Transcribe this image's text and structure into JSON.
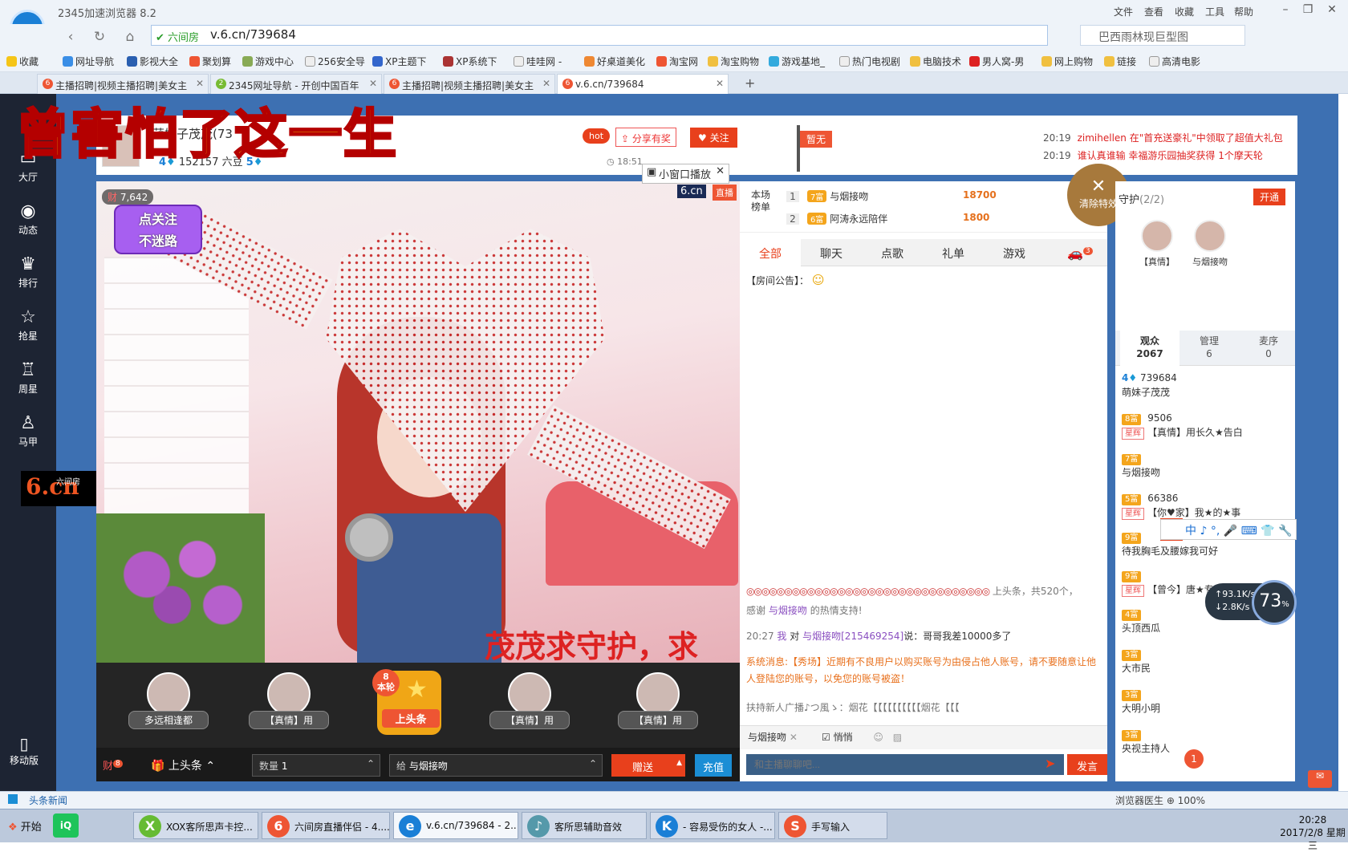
{
  "browser": {
    "app_title": "2345加速浏览器 8.2",
    "logo_letter": "e",
    "menus": [
      "文件",
      "查看",
      "收藏",
      "工具",
      "帮助"
    ],
    "url_badge": "六间房",
    "url": "v.6.cn/739684",
    "search_text": "巴西雨林现巨型图",
    "bookmarks": [
      "收藏",
      "网址导航",
      "影视大全",
      "聚划算",
      "游戏中心",
      "256安全导",
      "XP主题下",
      "XP系统下",
      "哇哇网 -",
      "好桌道美化",
      "淘宝网",
      "淘宝购物",
      "游戏基地_",
      "热门电视剧",
      "电脑技术",
      "男人窝-男",
      "网上购物",
      "链接",
      "高清电影"
    ],
    "tabs": [
      "主播招聘|视频主播招聘|美女主",
      "2345网址导航 - 开创中国百年",
      "主播招聘|视频主播招聘|美女主",
      "v.6.cn/739684"
    ]
  },
  "site": {
    "leftnav": [
      "大厅",
      "动态",
      "排行",
      "抢星",
      "周星",
      "马甲"
    ],
    "left_logo": "6.cn",
    "left_logo_label": "六间房",
    "mobile": "移动版",
    "overlay_lyric": "曾害怕了这一生",
    "anchor_name": "萌妹子茂茂(73",
    "anchor_level": "4",
    "anchor_beans": "152157 六豆",
    "anchor_beans_level": "5",
    "hot": "hot",
    "share": "分享有奖",
    "follow": "关注",
    "header_time": "18:51",
    "flag": "暂无",
    "sys_msgs": [
      {
        "time": "20:19",
        "text": "zimihellen 在\"首充送豪礼\"中领取了超值大礼包"
      },
      {
        "time": "20:19",
        "text": "谁认真谁输 幸福游乐园抽奖获得 1个摩天轮"
      }
    ]
  },
  "video": {
    "viewer_count": "7,642",
    "brand": "6.cn",
    "live": "直播",
    "popout": "小窗口播放",
    "follow_promo_1": "点关注",
    "follow_promo_2": "不迷路",
    "scroll_text": "茂茂求守护，求",
    "seats": [
      "多远相逢都",
      "【真情】用",
      "【真情】用",
      "【真情】用"
    ],
    "headline_round": "8",
    "headline_round_label": "本轮",
    "headline_label": "上头条"
  },
  "gift_bar": {
    "badge": "8",
    "wealth": "财",
    "gift_name": "上头条",
    "qty_label": "数量",
    "qty_value": "1",
    "to_label": "给",
    "to_value": "与烟接吻",
    "send": "赠送",
    "recharge": "充值"
  },
  "chat": {
    "rank_label": "本场榜单",
    "rank": [
      {
        "no": "1",
        "lv": "7富",
        "name": "与烟接吻",
        "amount": "18700"
      },
      {
        "no": "2",
        "lv": "6富",
        "name": "阿涛永远陪伴",
        "amount": "1800"
      }
    ],
    "clear_fx": "清除特效",
    "tabs": [
      "全部",
      "聊天",
      "点歌",
      "礼单",
      "游戏"
    ],
    "car_badge": "3",
    "notice": "【房间公告】：",
    "gift_ticker": "上头条，共520个，",
    "thanks_pre": "感谢",
    "thanks_name": "与烟接吻",
    "thanks_post": "的热情支持!",
    "whisper_time": "20:27",
    "whisper_me": "我",
    "whisper_to": "对",
    "whisper_target": "与烟接吻",
    "whisper_id": "[215469254]",
    "whisper_text": "说：哥哥我差10000多了",
    "sys_note": "系统消息:【秀场】近期有不良用户以购买账号为由侵占他人账号，请不要随意让他人登陆您的账号，以免您的账号被盗！",
    "announce": "扶持新人广播♪つ風ゝ：烟花【【【【【【【【【【烟花【【【",
    "target": "与烟接吻",
    "secret": "悄悄",
    "input_placeholder": "和主播聊聊吧...",
    "post": "发言"
  },
  "guard": {
    "label": "守护",
    "count": "(2/2)",
    "open": "开通",
    "members": [
      "【真情】",
      "与烟接吻"
    ]
  },
  "audience": {
    "tabs": [
      {
        "label": "观众",
        "count": "2067"
      },
      {
        "label": "管理",
        "count": "6"
      },
      {
        "label": "麦序",
        "count": "0"
      }
    ],
    "items": [
      {
        "lv": "4",
        "title": "",
        "id": "739684",
        "name": "萌妹子茂茂"
      },
      {
        "lv": "8富",
        "title": "星辉",
        "id": "9506",
        "name": "【真情】用长久★告白"
      },
      {
        "lv": "7富",
        "title": "",
        "id": "",
        "name": "与烟接吻"
      },
      {
        "lv": "5富",
        "title": "星辉",
        "id": "66386",
        "name": "【你♥家】我★的★事"
      },
      {
        "lv": "9富",
        "title": "",
        "id": "",
        "name": "待我胸毛及腰嫁我可好"
      },
      {
        "lv": "9富",
        "title": "星辉",
        "id": "",
        "name": "【曾今】唐★专"
      },
      {
        "lv": "4富",
        "title": "",
        "id": "",
        "name": "头顶西瓜"
      },
      {
        "lv": "3富",
        "title": "",
        "id": "",
        "name": "大市民"
      },
      {
        "lv": "3富",
        "title": "",
        "id": "",
        "name": "大明小明"
      },
      {
        "lv": "3富",
        "title": "",
        "id": "",
        "name": "央视主持人"
      }
    ]
  },
  "widgets": {
    "ime": "中 ♪ °, 🎤 ⌨ 👕 🔧",
    "up_speed": "93.1K/s",
    "down_speed": "2.8K/s",
    "cpu": "73",
    "mail_badge": "1"
  },
  "statusbar": {
    "news": "头条新闻",
    "right": "浏览器医生   ⊕ 100%"
  },
  "taskbar": {
    "start": "开始",
    "tasks": [
      "XOX客所思声卡控...",
      "六间房直播伴侣 - 4....",
      "v.6.cn/739684 - 2...",
      "客所思辅助音效",
      "- 容易受伤的女人 -...",
      "手写输入"
    ],
    "time": "20:28",
    "date": "2017/2/8 星期三"
  },
  "colors": {
    "accent": "#e8401c",
    "page_bg": "#3d70b2",
    "leftnav_bg": "#1d2433"
  }
}
